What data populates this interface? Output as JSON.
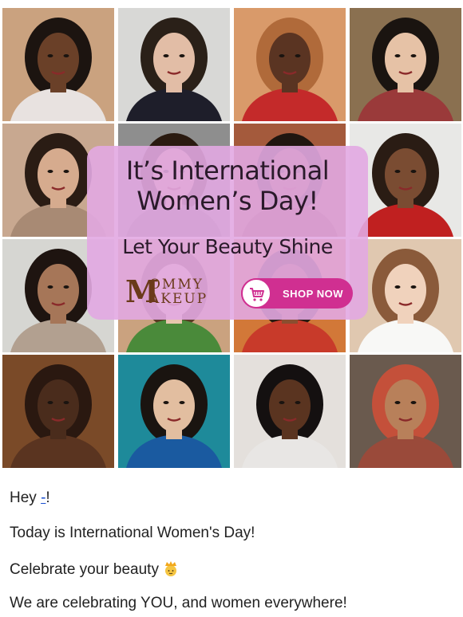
{
  "hero": {
    "photos": [
      {
        "alt": "woman-portrait-1",
        "bg": "#caa27f",
        "skin": "#6a4028",
        "hair": "#1c1410",
        "top": "#e8e2e0"
      },
      {
        "alt": "woman-portrait-2",
        "bg": "#d8d8d6",
        "skin": "#e2bda6",
        "hair": "#2a2018",
        "top": "#1e1e2a"
      },
      {
        "alt": "woman-portrait-3",
        "bg": "#d99a6a",
        "skin": "#5a3422",
        "hair": "#b06a3a",
        "top": "#c42a2a"
      },
      {
        "alt": "woman-portrait-4",
        "bg": "#8a7050",
        "skin": "#e6c2a6",
        "hair": "#1a1410",
        "top": "#9a3a3a"
      },
      {
        "alt": "woman-portrait-5",
        "bg": "#c8a890",
        "skin": "#d6ab8e",
        "hair": "#2a1c14",
        "top": "#a88a74"
      },
      {
        "alt": "woman-portrait-6",
        "bg": "#8e8e8e",
        "skin": "#d0a484",
        "hair": "#2a1a10",
        "top": "#6a6a6a"
      },
      {
        "alt": "woman-portrait-7",
        "bg": "#a45a3c",
        "skin": "#8a5234",
        "hair": "#201610",
        "top": "#7a2a1a"
      },
      {
        "alt": "woman-portrait-8",
        "bg": "#e8e8e6",
        "skin": "#7a4c32",
        "hair": "#2a1c14",
        "top": "#c02020"
      },
      {
        "alt": "woman-portrait-9",
        "bg": "#d6d6d2",
        "skin": "#a67658",
        "hair": "#1e1410",
        "top": "#b2a090"
      },
      {
        "alt": "woman-portrait-10",
        "bg": "#caa27f",
        "skin": "#e8c6ae",
        "hair": "#5a3a24",
        "top": "#4a8a3a"
      },
      {
        "alt": "woman-portrait-11",
        "bg": "#d27838",
        "skin": "#8a4e30",
        "hair": "#281a12",
        "top": "#c83a2a"
      },
      {
        "alt": "woman-portrait-12",
        "bg": "#e0c8b0",
        "skin": "#f0d2bc",
        "hair": "#8a5a3a",
        "top": "#f8f8f6"
      },
      {
        "alt": "woman-portrait-13",
        "bg": "#7a4a28",
        "skin": "#4a2c1c",
        "hair": "#2a1810",
        "top": "#5a3420"
      },
      {
        "alt": "woman-portrait-14",
        "bg": "#1e8a9a",
        "skin": "#e2bea0",
        "hair": "#1a1410",
        "top": "#1a5aa0"
      },
      {
        "alt": "woman-portrait-15",
        "bg": "#e4e0dc",
        "skin": "#5a3420",
        "hair": "#141010",
        "top": "#e8e6e4"
      },
      {
        "alt": "woman-portrait-16",
        "bg": "#6a5a4e",
        "skin": "#b8805a",
        "hair": "#c4503a",
        "top": "#9a4a3a"
      }
    ],
    "overlay": {
      "headline_line1": "It’s International",
      "headline_line2": "Women’s Day!",
      "tagline": "Let Your Beauty Shine",
      "logo_big_letter": "M",
      "logo_line1": "OMMY",
      "logo_line2": "AKEUP",
      "cta_label": "SHOP NOW",
      "cta_icon": "shopping-cart-icon",
      "cta_color": "#d02f91"
    }
  },
  "email": {
    "greeting_prefix": "Hey ",
    "greeting_name": "-",
    "greeting_suffix": "!",
    "line2": "Today is International Women's Day!",
    "line3": "Celebrate your beauty",
    "line3_emoji": "princess-crown-emoji",
    "line4": "We are celebrating YOU, and women everywhere!"
  }
}
